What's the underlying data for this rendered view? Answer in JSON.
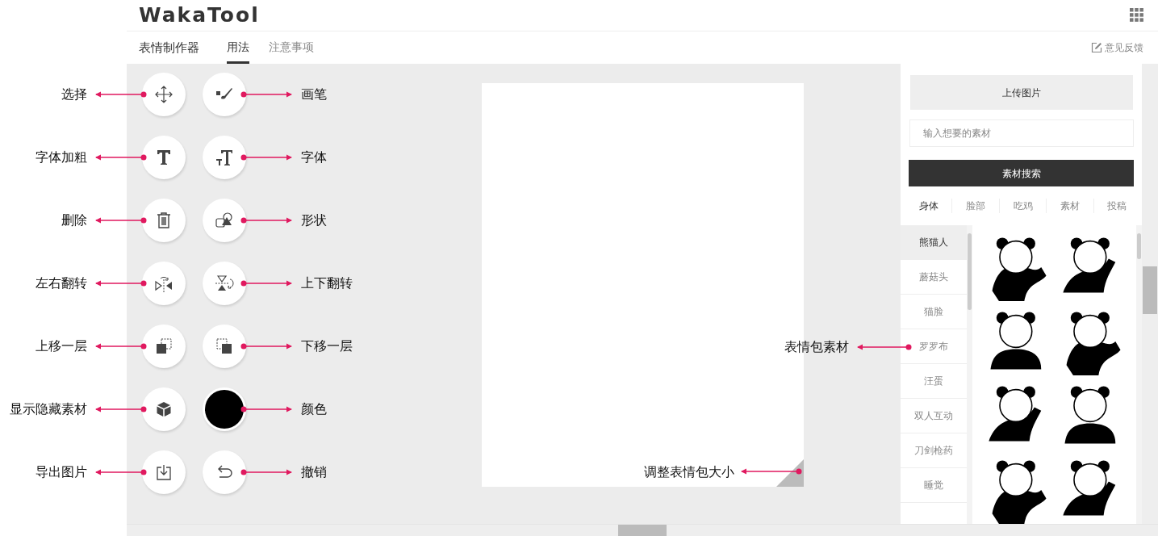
{
  "header": {
    "logo": "WakaTool"
  },
  "nav": {
    "title": "表情制作器",
    "tabs": [
      {
        "label": "用法",
        "selected": true
      },
      {
        "label": "注意事项",
        "selected": false
      }
    ],
    "feedback": "意见反馈"
  },
  "tool_rows": [
    [
      {
        "kind": "move",
        "annotation": "选择"
      },
      {
        "kind": "brush",
        "annotation": "画笔"
      }
    ],
    [
      {
        "kind": "bold",
        "annotation": "字体加粗"
      },
      {
        "kind": "font",
        "annotation": "字体"
      }
    ],
    [
      {
        "kind": "trash",
        "annotation": "删除"
      },
      {
        "kind": "shape",
        "annotation": "形状"
      }
    ],
    [
      {
        "kind": "flip-h",
        "annotation": "左右翻转"
      },
      {
        "kind": "flip-v",
        "annotation": "上下翻转"
      }
    ],
    [
      {
        "kind": "layer-up",
        "annotation": "上移一层"
      },
      {
        "kind": "layer-down",
        "annotation": "下移一层"
      }
    ],
    [
      {
        "kind": "cube",
        "annotation": "显示隐藏素材"
      },
      {
        "kind": "color",
        "color": "#000000",
        "annotation": "颜色"
      }
    ],
    [
      {
        "kind": "export",
        "annotation": "导出图片"
      },
      {
        "kind": "undo",
        "annotation": "撤销"
      }
    ]
  ],
  "canvas": {
    "annotation": "调整表情包大小"
  },
  "materials": {
    "upload_button": "上传图片",
    "search": {
      "placeholder": "输入想要的素材"
    },
    "search_button": "素材搜索",
    "categories": [
      {
        "label": "身体",
        "selected": true
      },
      {
        "label": "脸部",
        "selected": false
      },
      {
        "label": "吃鸡",
        "selected": false
      },
      {
        "label": "素材",
        "selected": false
      },
      {
        "label": "投稿",
        "selected": false
      }
    ],
    "subcategories": [
      {
        "label": "熊猫人",
        "selected": true
      },
      {
        "label": "蘑菇头",
        "selected": false
      },
      {
        "label": "猫脸",
        "selected": false
      },
      {
        "label": "罗罗布",
        "selected": false,
        "annotation": "表情包素材"
      },
      {
        "label": "汪蛋",
        "selected": false
      },
      {
        "label": "双人互动",
        "selected": false
      },
      {
        "label": "刀剑枪药",
        "selected": false
      },
      {
        "label": "睡觉",
        "selected": false
      }
    ]
  }
}
